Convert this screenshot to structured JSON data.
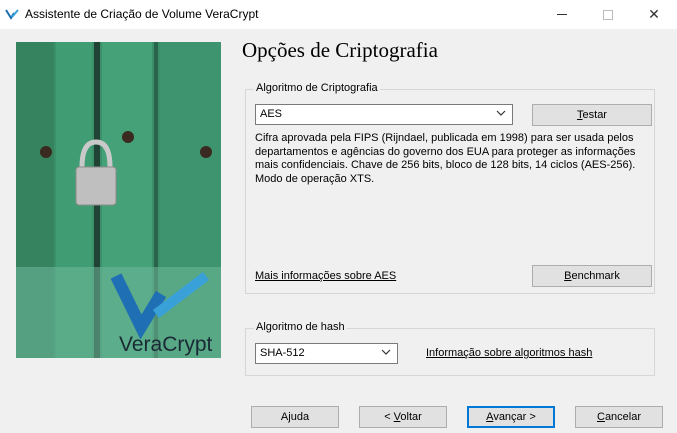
{
  "window": {
    "title": "Assistente de Criação de Volume VeraCrypt",
    "minimize_glyph": "—",
    "close_glyph": "✕"
  },
  "banner": {
    "brand_text": "VeraCrypt"
  },
  "page": {
    "title": "Opções de Criptografia"
  },
  "encryption": {
    "legend": "Algoritmo de Criptografia",
    "selected": "AES",
    "test_button": {
      "pre": "",
      "mnemonic": "T",
      "post": "estar"
    },
    "description": "Cifra aprovada pela FIPS (Rijndael, publicada em 1998) para ser usada pelos departamentos e agências do governo dos EUA para proteger as informações mais confidenciais. Chave de 256 bits, bloco de 128 bits, 14 ciclos (AES-256). Modo de operação XTS.",
    "more_info_link": "Mais informações sobre AES",
    "benchmark_button": {
      "pre": "",
      "mnemonic": "B",
      "post": "enchmark"
    }
  },
  "hash": {
    "legend": "Algoritmo de hash",
    "selected": "SHA-512",
    "info_link": "Informação sobre algoritmos hash"
  },
  "footer": {
    "help": "Ajuda",
    "back": {
      "pre": "< ",
      "mnemonic": "V",
      "post": "oltar"
    },
    "next": {
      "pre": "",
      "mnemonic": "A",
      "post": "vançar >"
    },
    "cancel": {
      "pre": "",
      "mnemonic": "C",
      "post": "ancelar"
    }
  },
  "colors": {
    "accent": "#0078d7",
    "banner_green": "#2f8f63"
  }
}
